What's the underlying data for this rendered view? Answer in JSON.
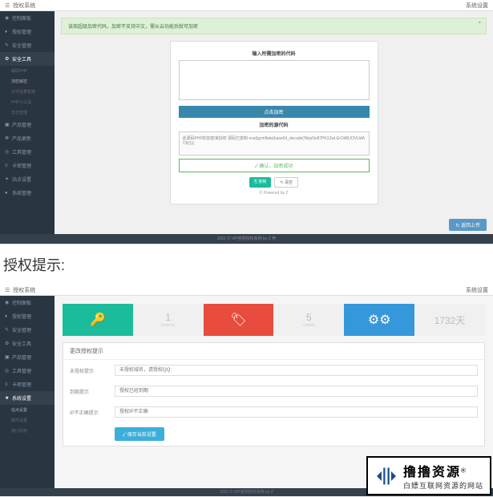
{
  "app_title": "授权系统",
  "topbar_right": "系统设置",
  "sidebar": {
    "items": [
      {
        "icon": "◉",
        "label": "控制面板"
      },
      {
        "icon": "♦",
        "label": "授权管理"
      },
      {
        "icon": "✎",
        "label": "安全管理"
      },
      {
        "icon": "⚙",
        "label": "安全工具"
      },
      {
        "icon": "▣",
        "label": "产品管理"
      },
      {
        "icon": "❁",
        "label": "产品更新"
      },
      {
        "icon": "◎",
        "label": "工具管理"
      },
      {
        "icon": "≡",
        "label": "卡密管理"
      },
      {
        "icon": "✦",
        "label": "站点设置"
      },
      {
        "icon": "●",
        "label": "系统管理"
      }
    ],
    "subs": [
      "解码PHP",
      "加密解密",
      "文件批量替换",
      "PHP小工具",
      "日志管理"
    ]
  },
  "alert_text": "该商超级加密代码，加密不支持中文，需从云功能后就可加密",
  "alert_close": "×",
  "panel": {
    "input_label": "输入所需加密的代码",
    "encrypt_btn": "点击加密",
    "result_label": "加密的源代码",
    "result_text": "此源码PHP的加密来授权 源码已复制 eval(gzinflate(base64_decode('MzpNz87PK1ZwLErOABJOVUdA73tj')));",
    "verify_btn": "✓ 确认，加密成功",
    "copy_btn": "⎘ 复制",
    "clear_btn": "✎ 清空",
    "powered": "© Powered by Z"
  },
  "go_top": "↻ 返回上传",
  "footer1": "2021 © VIP官网授权系统 by Z 壳",
  "divider_heading": "授权提示:",
  "sidebar2": {
    "items": [
      {
        "icon": "◉",
        "label": "控制面板"
      },
      {
        "icon": "♦",
        "label": "授权管理"
      },
      {
        "icon": "✎",
        "label": "安全管理"
      },
      {
        "icon": "⚙",
        "label": "安全工具"
      },
      {
        "icon": "▣",
        "label": "产品管理"
      },
      {
        "icon": "◎",
        "label": "工具管理"
      },
      {
        "icon": "≡",
        "label": "卡密管理"
      },
      {
        "icon": "★",
        "label": "系统设置"
      }
    ],
    "subs": [
      "站点设置",
      "邮件设置",
      "接口授权"
    ]
  },
  "stats": {
    "s1_num": "1",
    "s1_lbl": "License",
    "s2_num": "5",
    "s2_lbl": "unlock",
    "s3_num": "1732天",
    "s3_lbl": ""
  },
  "form": {
    "heading": "更改授权提示",
    "rows": [
      {
        "label": "未授权提示",
        "placeholder": "未授权域名，请授权QQ:"
      },
      {
        "label": "到期提示",
        "placeholder": "授权已经到期"
      },
      {
        "label": "IP不正确提示",
        "placeholder": "授权IP不正确"
      }
    ],
    "save_btn": "✓ 保存当前设置"
  },
  "footer2": "2021 © VIP官网授权系统 by Z",
  "watermark": {
    "brand": "撸撸资源",
    "reg": "®",
    "sub": "白嫖互联网资源的网站"
  }
}
